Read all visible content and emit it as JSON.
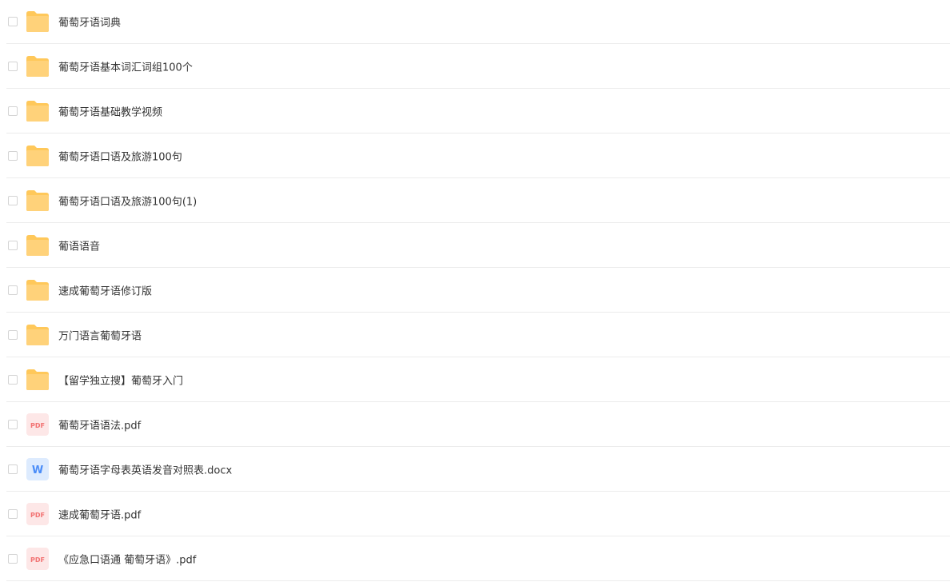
{
  "files": [
    {
      "name": "葡萄牙语词典",
      "type": "folder",
      "icon": "folder-icon"
    },
    {
      "name": "葡萄牙语基本词汇词组100个",
      "type": "folder",
      "icon": "folder-icon"
    },
    {
      "name": "葡萄牙语基础教学视频",
      "type": "folder",
      "icon": "folder-icon"
    },
    {
      "name": "葡萄牙语口语及旅游100句",
      "type": "folder",
      "icon": "folder-icon"
    },
    {
      "name": "葡萄牙语口语及旅游100句(1)",
      "type": "folder",
      "icon": "folder-icon"
    },
    {
      "name": "葡语语音",
      "type": "folder",
      "icon": "folder-icon"
    },
    {
      "name": "速成葡萄牙语修订版",
      "type": "folder",
      "icon": "folder-icon"
    },
    {
      "name": "万门语言葡萄牙语",
      "type": "folder",
      "icon": "folder-icon"
    },
    {
      "name": "【留学独立搜】葡萄牙入门",
      "type": "folder",
      "icon": "folder-icon"
    },
    {
      "name": "葡萄牙语语法.pdf",
      "type": "pdf",
      "icon": "pdf-icon",
      "icon_label": "PDF"
    },
    {
      "name": "葡萄牙语字母表英语发音对照表.docx",
      "type": "docx",
      "icon": "word-icon",
      "icon_label": "W"
    },
    {
      "name": "速成葡萄牙语.pdf",
      "type": "pdf",
      "icon": "pdf-icon",
      "icon_label": "PDF"
    },
    {
      "name": "《应急口语通 葡萄牙语》.pdf",
      "type": "pdf",
      "icon": "pdf-icon",
      "icon_label": "PDF"
    }
  ],
  "colors": {
    "folder_back": "#FFC85A",
    "folder_front": "#FFD27A",
    "pdf_bg": "#FDE7E7",
    "pdf_text": "#F27272",
    "word_bg": "#DDEBFE",
    "word_text": "#4B8DF8",
    "text": "#333333",
    "divider": "#ECECEC"
  }
}
